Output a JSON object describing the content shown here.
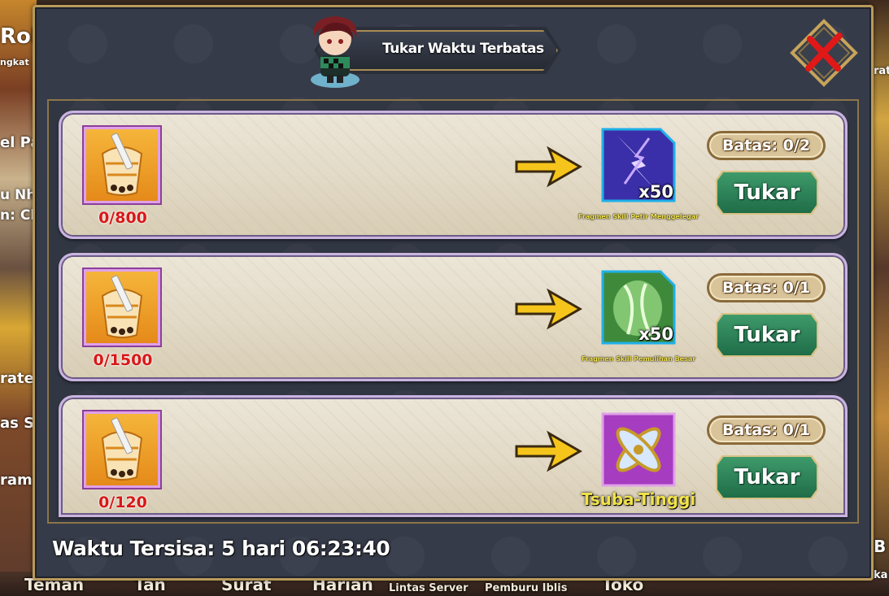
{
  "background": {
    "left_labels": [
      "Rok",
      "ngkat",
      "el Pa",
      "u Nh",
      "n: Cl",
      "rate",
      "as S",
      "ramp"
    ],
    "bottom_labels": [
      "Teman",
      "Tan",
      "Surat",
      "Harian",
      "Lintas Server",
      "Pemburu Iblis",
      "Toko"
    ],
    "right_labels": [
      "rate",
      "B",
      "ka"
    ]
  },
  "dialog": {
    "title": "Tukar Waktu Terbatas",
    "close_icon": "close-x-icon",
    "accent_color": "#b89a5a",
    "time_left_label": "Waktu Tersisa: 5 hari 06:23:40"
  },
  "offers": [
    {
      "cost_icon": "bubble-tea-icon",
      "cost_count": "0/800",
      "reward_icon": "lightning-skill-fragment-icon",
      "reward_qty": "x50",
      "reward_name": "Fragmen Skill Petir Menggelegar",
      "limit": "Batas: 0/2",
      "button": "Tukar"
    },
    {
      "cost_icon": "bubble-tea-icon",
      "cost_count": "0/1500",
      "reward_icon": "healing-skill-fragment-icon",
      "reward_qty": "x50",
      "reward_name": "Fragmen Skill Pemulihan Besar",
      "limit": "Batas: 0/1",
      "button": "Tukar"
    },
    {
      "cost_icon": "bubble-tea-icon",
      "cost_count": "0/120",
      "reward_icon": "tsuba-guard-icon",
      "reward_qty": "",
      "reward_name": "Tsuba-Tinggi",
      "limit": "Batas: 0/1",
      "button": "Tukar"
    }
  ]
}
